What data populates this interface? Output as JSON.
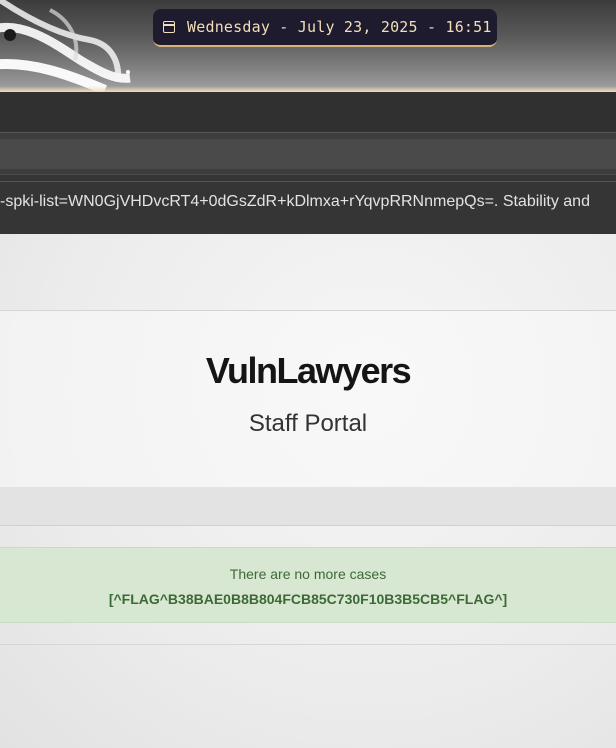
{
  "desktop": {
    "clock_text": "Wednesday - July 23, 2025 - 16:51",
    "clock_icon": "calendar-icon"
  },
  "browser": {
    "info_text": "-spki-list=WN0GjVHDvcRT4+0dGsZdR+kDlmxa+rYqvpRRNnmepQs=. Stability and"
  },
  "page": {
    "title": "VulnLawyers",
    "subtitle": "Staff Portal",
    "alert_message": "There are no more cases",
    "alert_flag": "[^FLAG^B38BAE0B8B804FCB85C730F10B3B5CB5^FLAG^]"
  },
  "colors": {
    "clock_bg": "#1e1b2e",
    "clock_text": "#f2dfb9",
    "alert_bg": "#d8e7d2",
    "alert_text": "#3c6a35"
  }
}
